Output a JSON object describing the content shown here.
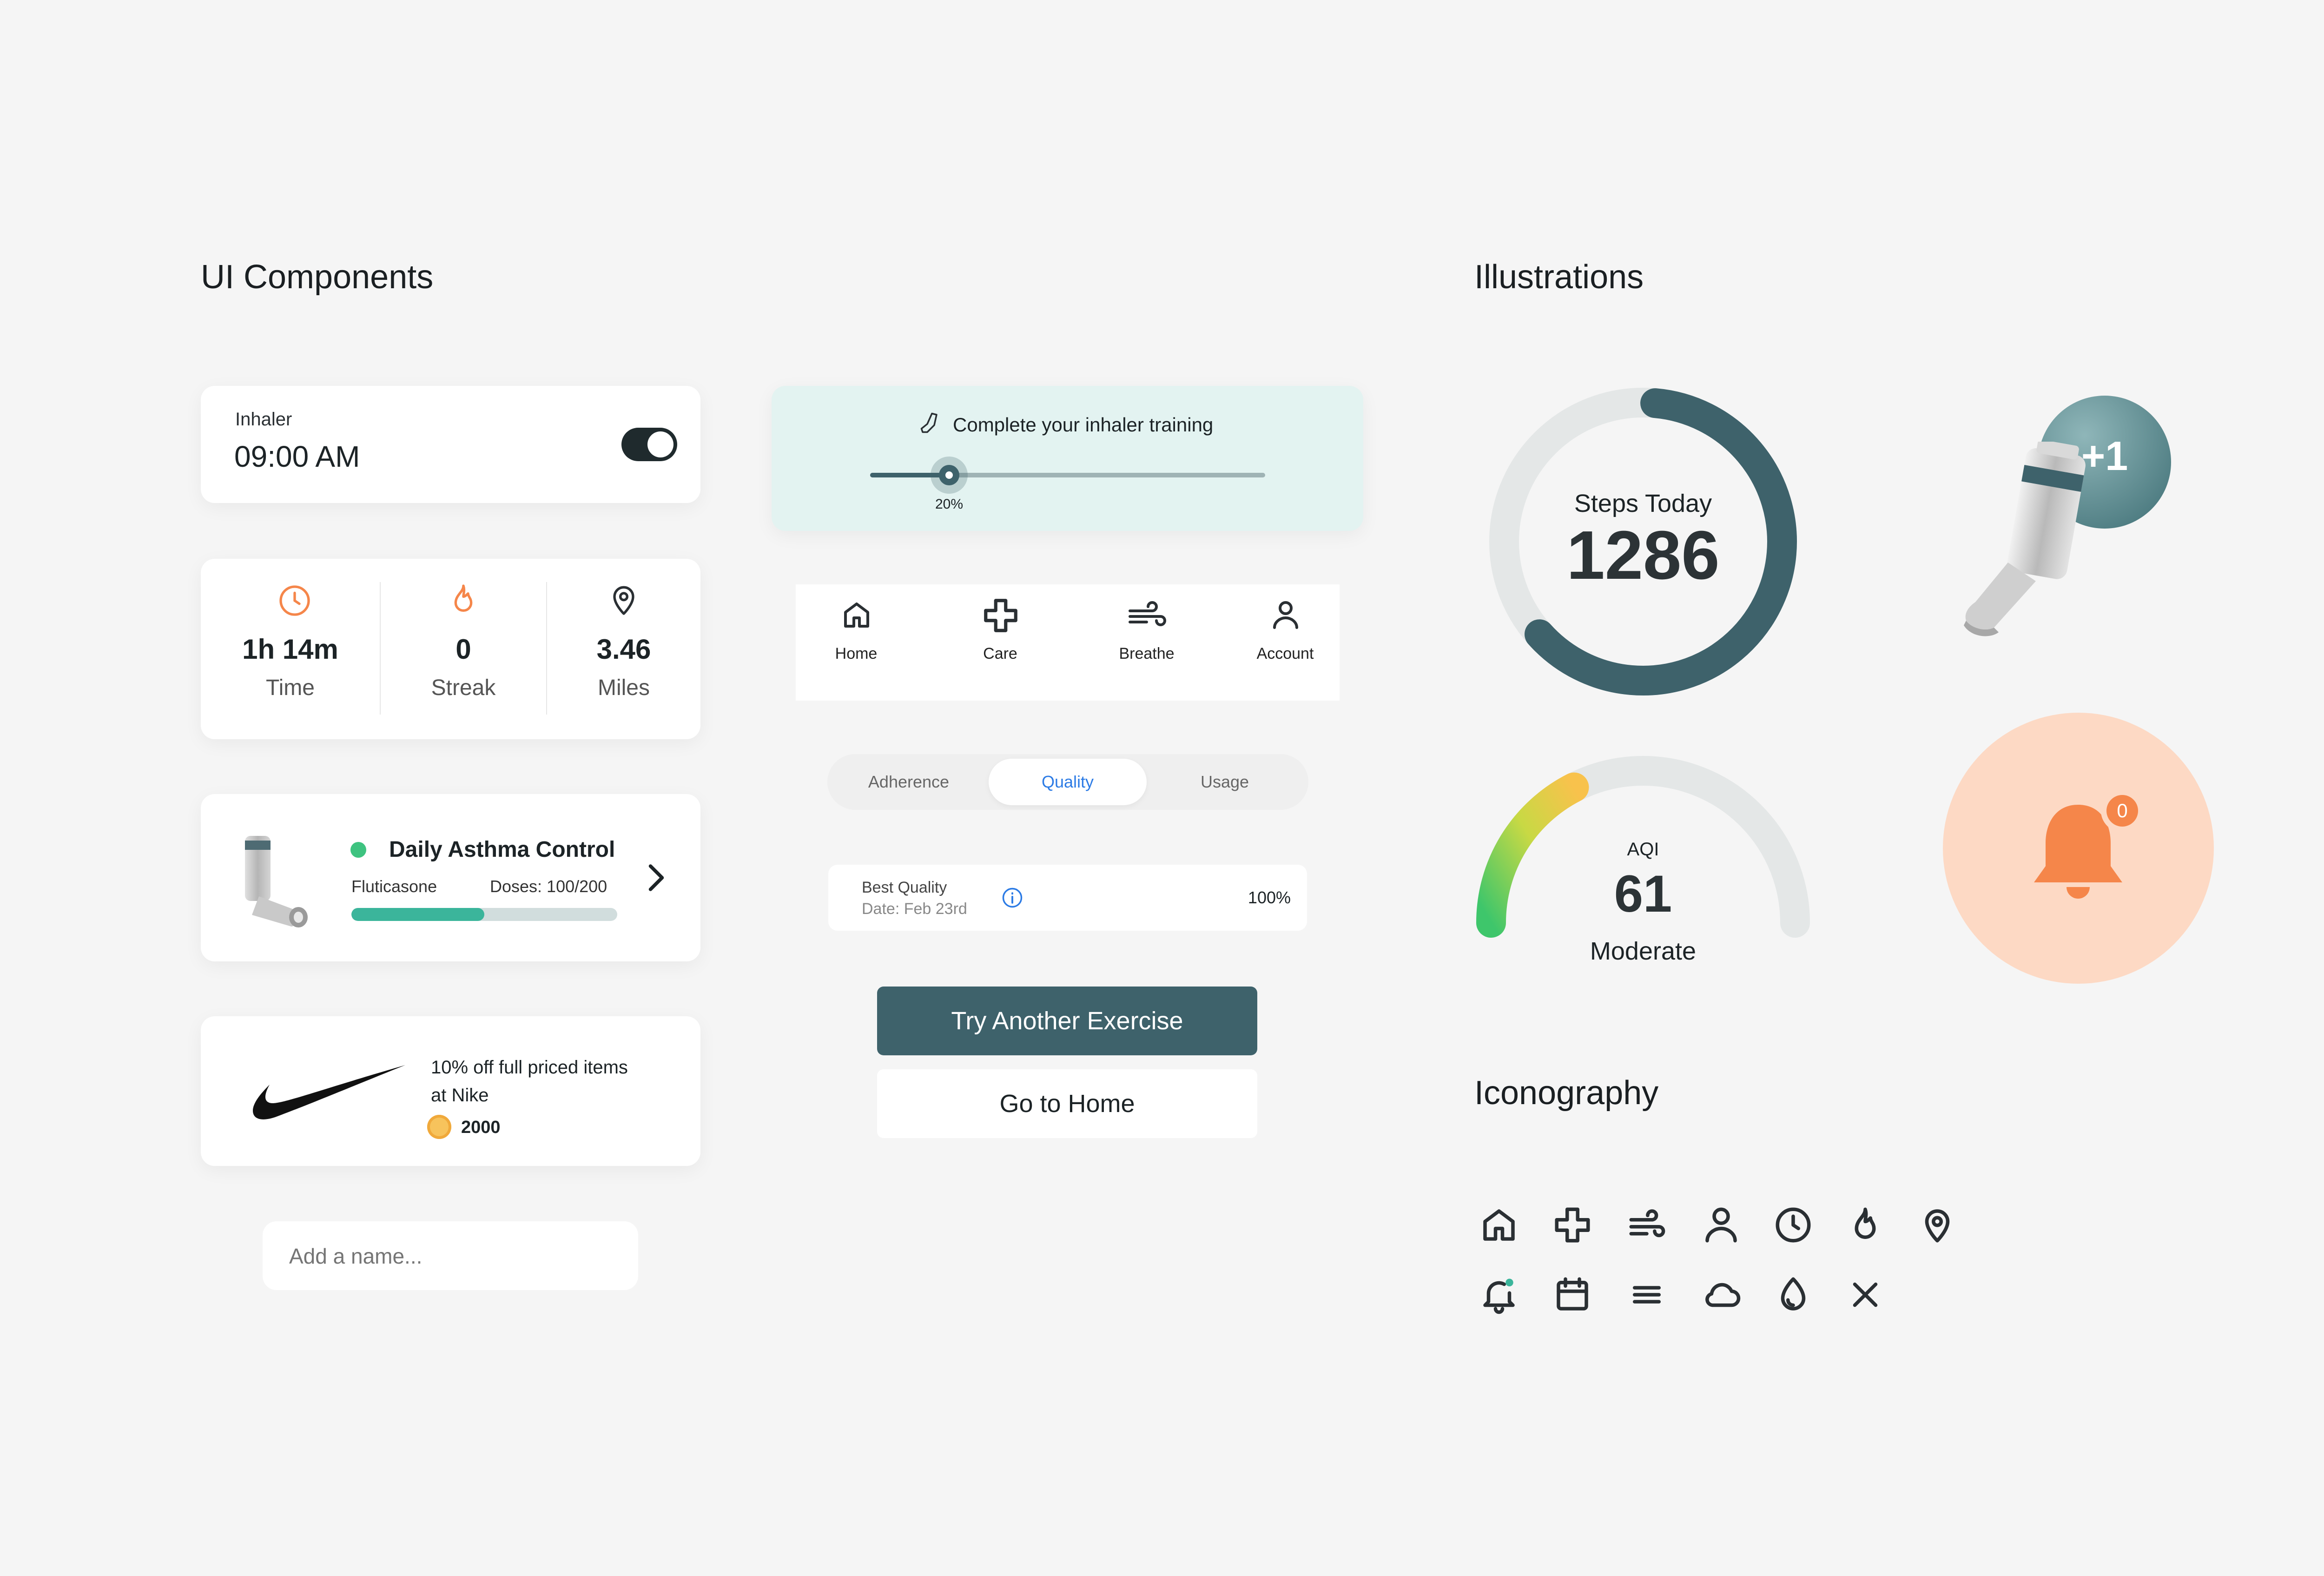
{
  "sections": {
    "ui_components": "UI Components",
    "illustrations": "Illustrations",
    "iconography": "Iconography"
  },
  "inhaler_card": {
    "label": "Inhaler",
    "time": "09:00 AM",
    "toggle_on": true
  },
  "stats_card": {
    "items": [
      {
        "icon": "clock-icon",
        "value": "1h 14m",
        "label": "Time"
      },
      {
        "icon": "flame-icon",
        "value": "0",
        "label": "Streak"
      },
      {
        "icon": "location-pin-icon",
        "value": "3.46",
        "label": "Miles"
      }
    ]
  },
  "med_card": {
    "title": "Daily Asthma Control",
    "drug": "Fluticasone",
    "doses": "Doses: 100/200",
    "progress": 0.5
  },
  "promo_card": {
    "line1": "10% off full priced items",
    "line2": "at Nike",
    "points": "2000"
  },
  "name_input": {
    "placeholder": "Add a name..."
  },
  "training_banner": {
    "text": "Complete your inhaler training",
    "percent_label": "20%",
    "progress": 0.2
  },
  "bottom_nav": {
    "items": [
      {
        "icon": "home-icon",
        "label": "Home"
      },
      {
        "icon": "plus-cross-icon",
        "label": "Care"
      },
      {
        "icon": "wind-icon",
        "label": "Breathe"
      },
      {
        "icon": "user-icon",
        "label": "Account"
      }
    ]
  },
  "segmented": {
    "items": [
      "Adherence",
      "Quality",
      "Usage"
    ],
    "selected": "Quality"
  },
  "quality_row": {
    "title": "Best Quality",
    "date": "Date: Feb 23rd",
    "value": "100%"
  },
  "buttons": {
    "primary": "Try Another Exercise",
    "secondary": "Go to Home"
  },
  "steps_ring": {
    "label": "Steps Today",
    "value": "1286",
    "progress": 0.62
  },
  "aqi_gauge": {
    "label": "AQI",
    "value": "61",
    "status": "Moderate",
    "level": 0.35
  },
  "badge_illustration": {
    "text": "+1"
  },
  "bell_illustration": {
    "count": "0"
  },
  "colors": {
    "primary": "#3e626b",
    "teal": "#3bb59b",
    "orange": "#f5864a",
    "peach": "#fdd9c4",
    "banner_bg": "#e3f3f1",
    "blue": "#2c7be5"
  },
  "icon_grid": [
    "home-icon",
    "plus-cross-icon",
    "wind-icon",
    "user-icon",
    "clock-icon",
    "flame-icon",
    "location-pin-icon",
    "bell-notification-icon",
    "calendar-icon",
    "menu-icon",
    "cloud-icon",
    "droplet-icon",
    "close-icon"
  ]
}
